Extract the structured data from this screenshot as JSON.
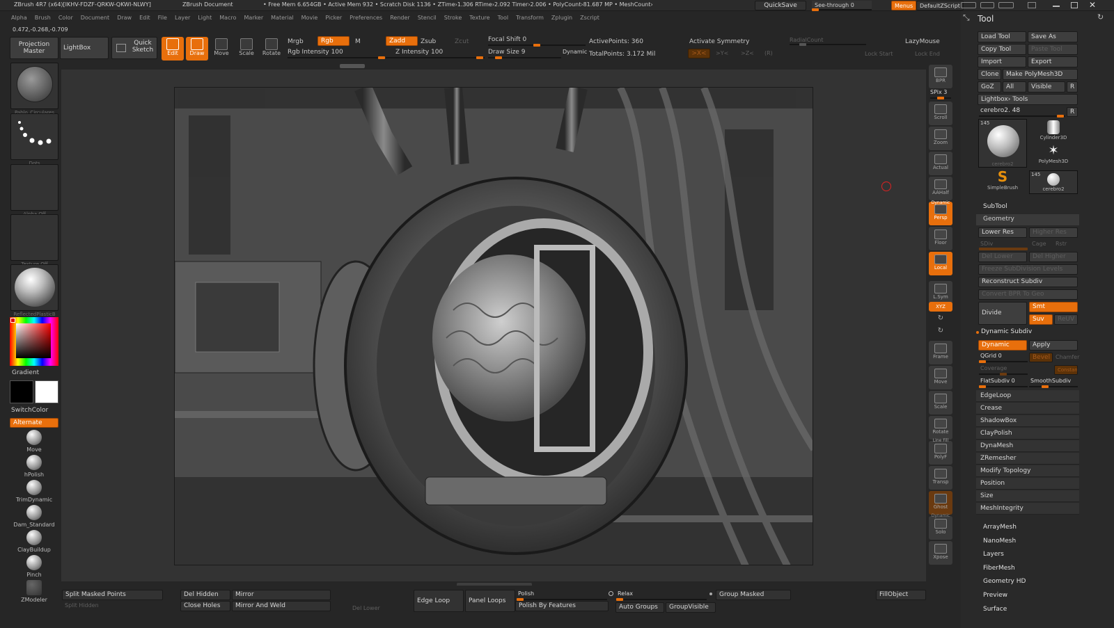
{
  "titlebar": {
    "title": "ZBrush 4R7 (x64)[IKHV-FDZF-QRKW-QKWI-NLWY]",
    "doc": "ZBrush Document",
    "status": "• Free Mem 6.654GB • Active Mem 932 • Scratch Disk 1136 • ZTime›1.306 RTime›2.092 Timer›2.006 • PolyCount›81.687 MP • MeshCount›",
    "quicksave": "QuickSave",
    "see_through": "See-through  0",
    "menus": "Menus",
    "default_zscript": "DefaultZScript"
  },
  "menubar": [
    "Alpha",
    "Brush",
    "Color",
    "Document",
    "Draw",
    "Edit",
    "File",
    "Layer",
    "Light",
    "Macro",
    "Marker",
    "Material",
    "Movie",
    "Picker",
    "Preferences",
    "Render",
    "Stencil",
    "Stroke",
    "Texture",
    "Tool",
    "Transform",
    "Zplugin",
    "Zscript"
  ],
  "coords": "0.472,-0.268,-0.709",
  "toolbar": {
    "projection_master": "Projection Master",
    "lightbox": "LightBox",
    "quick_sketch": "Quick Sketch",
    "edit": "Edit",
    "draw": "Draw",
    "move": "Move",
    "scale": "Scale",
    "rotate": "Rotate",
    "mrgb": "Mrgb",
    "rgb": "Rgb",
    "m": "M",
    "rgb_intensity": "Rgb Intensity 100",
    "zadd": "Zadd",
    "zsub": "Zsub",
    "zcut": "Zcut",
    "z_intensity": "Z Intensity 100",
    "focal_shift": "Focal Shift 0",
    "draw_size": "Draw Size 9",
    "dynamic": "Dynamic",
    "active_points": "ActivePoints: 360",
    "total_points": "TotalPoints: 3.172 Mil",
    "activate_symmetry": "Activate Symmetry",
    "radial_count": "RadialCount",
    "x": ">X<",
    "y": ">Y<",
    "z": ">Z<",
    "r": "(R)",
    "lazymouse": "LazyMouse",
    "lock_start": "Lock Start",
    "lock_end": "Lock End"
  },
  "leftshelf": {
    "brush_name": "Pablo_Circulares",
    "stroke_name": "Dots",
    "alpha": "Alpha Off",
    "texture": "Texture Off",
    "material": "ReflectedPlasticB",
    "gradient": "Gradient",
    "switch_color": "SwitchColor",
    "alternate": "Alternate",
    "brushes": [
      "Move",
      "hPolish",
      "TrimDynamic",
      "Dam_Standard",
      "ClayBuildup",
      "Pinch",
      "ZModeler"
    ]
  },
  "rightshelf": [
    "BPR",
    "SPix 3",
    "Scroll",
    "Zoom",
    "Actual",
    "AAHalf",
    "Persp",
    "Floor",
    "Local",
    "L.Sym",
    "XYZ",
    "",
    "",
    "Frame",
    "Move",
    "Scale",
    "Rotate",
    "PolyF",
    "Transp",
    "Ghost",
    "Solo",
    "Xpose"
  ],
  "rightshelf_top_labels": {
    "dynamic": "Dynamic",
    "line_fill": "Line Fill",
    "dynamic2": "Dynamic"
  },
  "toolpanel": {
    "title": "Tool",
    "load_tool": "Load Tool",
    "save_as": "Save As",
    "copy_tool": "Copy Tool",
    "paste_tool": "Paste Tool",
    "import": "Import",
    "export": "Export",
    "clone": "Clone",
    "make_polymesh": "Make PolyMesh3D",
    "goz": "GoZ",
    "all": "All",
    "visible": "Visible",
    "r": "R",
    "lightbox_tools": "Lightbox› Tools",
    "current_tool": "cerebro2. 48",
    "thumb_count1": "145",
    "thumb_count2": "145",
    "thumbs": [
      "cerebro2",
      "Cylinder3D",
      "PolyMesh3D",
      "SimpleBrush",
      "cerebro2"
    ],
    "subtool": "SubTool",
    "geometry": "Geometry",
    "lower_res": "Lower Res",
    "higher_res": "Higher Res",
    "sdiv": "SDiv",
    "cage": "Cage",
    "rstr": "Rstr",
    "del_lower": "Del Lower",
    "del_higher": "Del Higher",
    "freeze": "Freeze SubDivision Levels",
    "reconstruct": "Reconstruct Subdiv",
    "convert_bpr": "Convert BPR To Geo",
    "divide": "Divide",
    "smt": "Smt",
    "suv": "Suv",
    "reuv": "ReUV",
    "dynamic_subdiv": "Dynamic Subdiv",
    "dynamic": "Dynamic",
    "apply": "Apply",
    "qgrid": "QGrid 0",
    "bevel": "Bevel",
    "chamfer": "Chamfer",
    "coverage": "Coverage",
    "constant": "Constant",
    "flatsubdiv": "FlatSubdiv 0",
    "smoothsubdiv": "SmoothSubdiv",
    "sections": [
      "EdgeLoop",
      "Crease",
      "ShadowBox",
      "ClayPolish",
      "DynaMesh",
      "ZRemesher",
      "Modify Topology",
      "Position",
      "Size",
      "MeshIntegrity"
    ],
    "sub_sections": [
      "ArrayMesh",
      "NanoMesh",
      "Layers",
      "FiberMesh",
      "Geometry HD",
      "Preview",
      "Surface"
    ]
  },
  "bottombar": {
    "split_masked": "Split Masked Points",
    "split_hidden": "Split Hidden",
    "del_hidden": "Del Hidden",
    "close_holes": "Close Holes",
    "mirror": "Mirror",
    "mirror_weld": "Mirror And Weld",
    "del_lower": "Del Lower",
    "edge_loop": "Edge Loop",
    "panel_loops": "Panel Loops",
    "polish": "Polish",
    "polish_features": "Polish By Features",
    "relax": "Relax",
    "auto_groups": "Auto Groups",
    "group_visible": "GroupVisible",
    "group_masked": "Group Masked",
    "fill_object": "FillObject"
  },
  "colors": {
    "accent": "#e86f0c",
    "bg": "#262626",
    "panel": "#333333",
    "canvas": "#3a3a3a"
  }
}
